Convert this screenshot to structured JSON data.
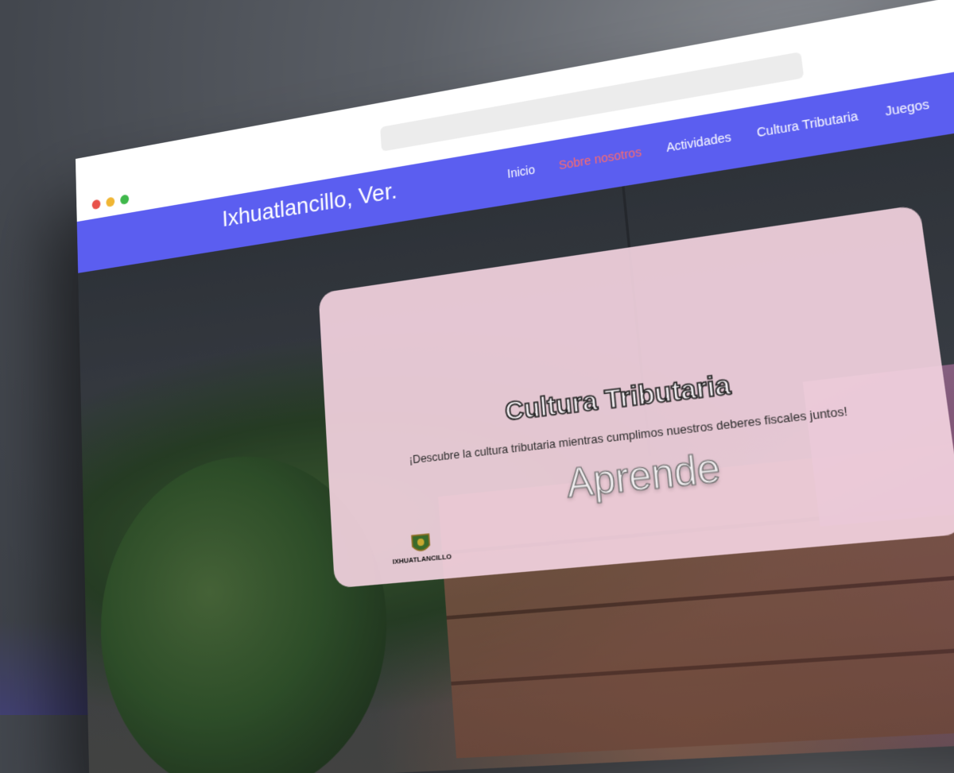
{
  "header": {
    "brand": "Ixhuatlancillo, Ver."
  },
  "nav": {
    "items": [
      {
        "label": "Inicio",
        "active": false
      },
      {
        "label": "Sobre nosotros",
        "active": true
      },
      {
        "label": "Actividades",
        "active": false
      },
      {
        "label": "Cultura Tributaria",
        "active": false
      },
      {
        "label": "Juegos",
        "active": false
      }
    ]
  },
  "hero": {
    "title": "Cultura Tributaria",
    "subtitle": "¡Descubre la cultura tributaria mientras cumplimos nuestros deberes fiscales juntos!",
    "animated_word": "Aprende",
    "logo_text": "IXHUATLANCILLO"
  },
  "colors": {
    "navbar": "#5b5ef0",
    "nav_active": "#ff6a6a",
    "card_bg": "#f3d2e0"
  }
}
